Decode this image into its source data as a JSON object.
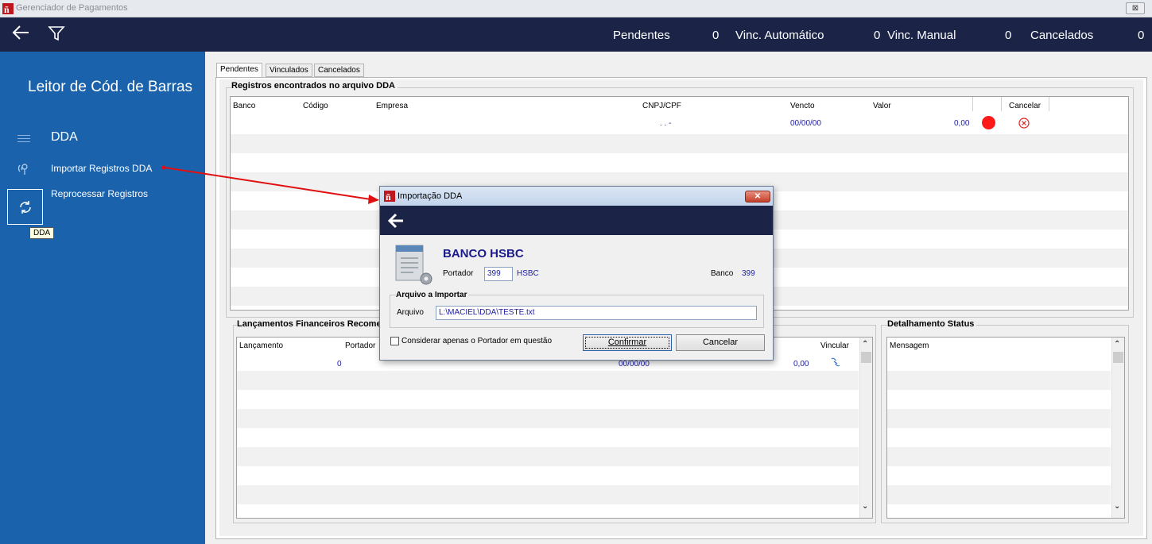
{
  "window": {
    "title": "Gerenciador de Pagamentos",
    "close_label": "⊠"
  },
  "topbar": {
    "counters": [
      {
        "label": "Pendentes",
        "value": "0"
      },
      {
        "label": "Vinc. Automático",
        "value": "0"
      },
      {
        "label": "Vinc. Manual",
        "value": "0"
      },
      {
        "label": "Cancelados",
        "value": "0"
      }
    ]
  },
  "sidebar": {
    "heading": "Leitor de Cód. de Barras",
    "section": "DDA",
    "items": [
      {
        "label": "Importar Registros DDA",
        "icon": "antenna-icon"
      },
      {
        "label": "Reprocessar Registros",
        "icon": "refresh-icon"
      }
    ],
    "tooltip": "DDA"
  },
  "tabs": [
    "Pendentes",
    "Vinculados",
    "Cancelados"
  ],
  "registros": {
    "title": "Registros encontrados no arquivo DDA",
    "columns": [
      "Banco",
      "Código",
      "Empresa",
      "CNPJ/CPF",
      "Vencto",
      "Valor",
      "Cancelar"
    ],
    "row": {
      "cnpj": ". . -",
      "vencto": "00/00/00",
      "valor": "0,00"
    }
  },
  "lancamentos": {
    "title": "Lançamentos Financeiros Recome",
    "columns": [
      "Lançamento",
      "Portador",
      "Vincular"
    ],
    "row": {
      "portador": "0",
      "vencto": "00/00/00",
      "valor": "0,00"
    }
  },
  "status": {
    "title": "Detalhamento Status",
    "columns": [
      "Mensagem"
    ]
  },
  "dialog": {
    "title": "Importação DDA",
    "bank_name": "BANCO HSBC",
    "portador_label": "Portador",
    "portador_value": "399",
    "portador_name": "HSBC",
    "banco_label": "Banco",
    "banco_value": "399",
    "group_title": "Arquivo a Importar",
    "arquivo_label": "Arquivo",
    "arquivo_value": "L:\\MACIEL\\DDA\\TESTE.txt",
    "checkbox_label": "Considerar apenas o Portador em questão",
    "confirm_label": "Confirmar",
    "cancel_label": "Cancelar"
  },
  "colors": {
    "topbar": "#1b2447",
    "sidebar": "#1a63ac",
    "status_dot": "#ff1a1a",
    "arrow": "#e01010"
  }
}
